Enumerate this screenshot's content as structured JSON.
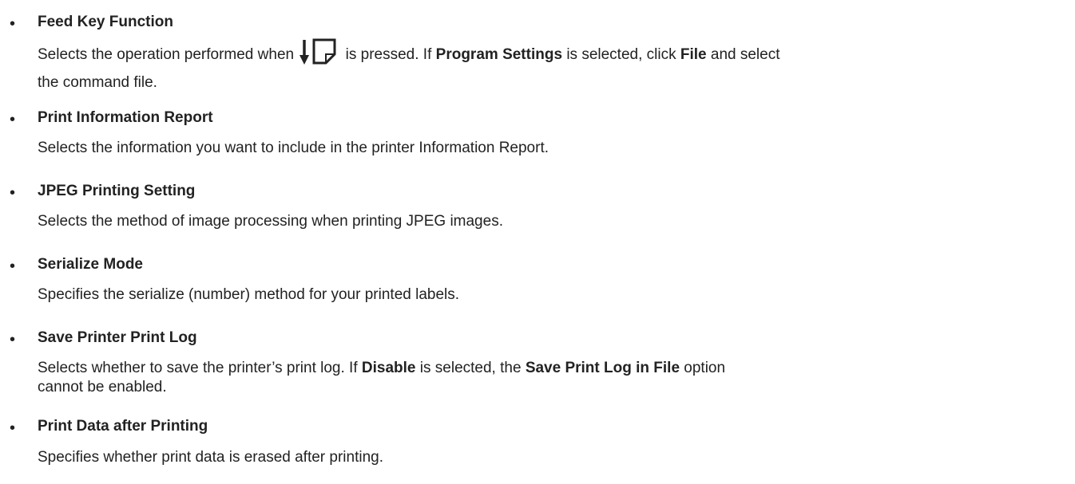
{
  "items": [
    {
      "title": "Feed Key Function",
      "desc": {
        "part1": "Selects the operation performed when",
        "part2": "is pressed. If",
        "bold1": "Program Settings",
        "part3": "is selected, click",
        "bold2": "File",
        "part4": "and select",
        "line2": "the command file."
      },
      "icon": "feed-key-icon"
    },
    {
      "title": "Print Information Report",
      "desc": "Selects the information you want to include in the printer Information Report."
    },
    {
      "title": "JPEG Printing Setting",
      "desc": "Selects the method of image processing when printing JPEG images."
    },
    {
      "title": "Serialize Mode",
      "desc": "Specifies the serialize (number) method for your printed labels."
    },
    {
      "title": "Save Printer Print Log",
      "desc": {
        "part1": "Selects whether to save the printer’s print log. If",
        "bold1": "Disable",
        "part2": "is selected, the",
        "bold2": "Save Print Log in File",
        "part3": "option",
        "line2": "cannot be enabled."
      }
    },
    {
      "title": "Print Data after Printing",
      "desc": "Specifies whether print data is erased after printing."
    }
  ]
}
